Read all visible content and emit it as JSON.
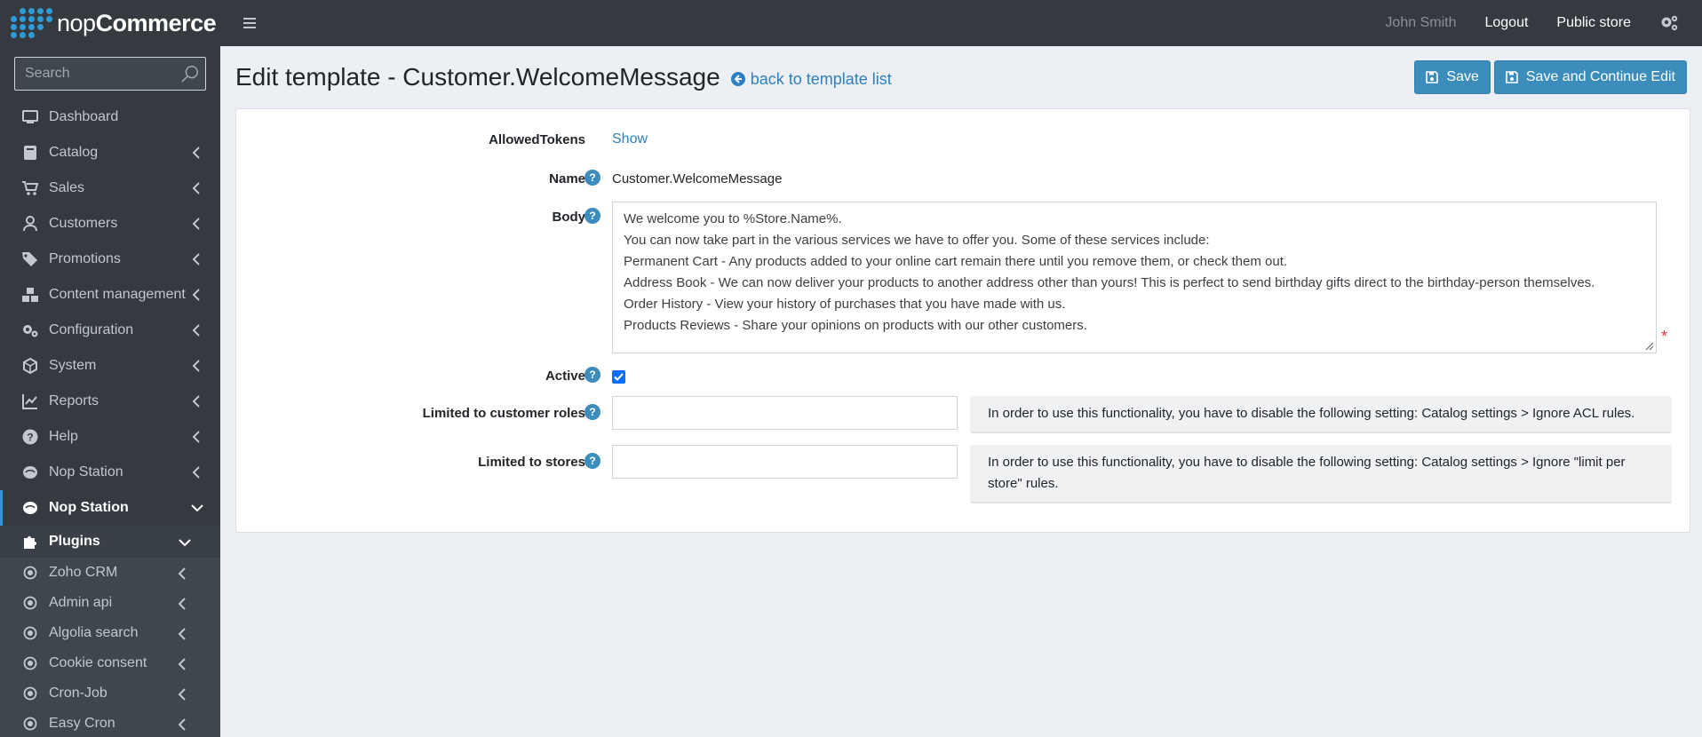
{
  "brand": {
    "name_bold": "nop",
    "name_rest": "Commerce"
  },
  "search": {
    "placeholder": "Search"
  },
  "sidebar": {
    "items": [
      {
        "label": "Dashboard",
        "icon": "monitor-icon"
      },
      {
        "label": "Catalog",
        "icon": "book-icon"
      },
      {
        "label": "Sales",
        "icon": "cart-icon"
      },
      {
        "label": "Customers",
        "icon": "user-icon"
      },
      {
        "label": "Promotions",
        "icon": "tags-icon"
      },
      {
        "label": "Content management",
        "icon": "cubes-icon"
      },
      {
        "label": "Configuration",
        "icon": "cogs-icon"
      },
      {
        "label": "System",
        "icon": "cube-icon"
      },
      {
        "label": "Reports",
        "icon": "chart-icon"
      },
      {
        "label": "Help",
        "icon": "question-icon"
      },
      {
        "label": "Nop Station",
        "icon": "nopstation-icon"
      },
      {
        "label": "Nop Station",
        "icon": "nopstation-icon"
      }
    ],
    "plugins_label": "Plugins",
    "plugin_items": [
      {
        "label": "Zoho CRM"
      },
      {
        "label": "Admin api"
      },
      {
        "label": "Algolia search"
      },
      {
        "label": "Cookie consent"
      },
      {
        "label": "Cron-Job"
      },
      {
        "label": "Easy Cron"
      }
    ]
  },
  "topbar": {
    "user": "John Smith",
    "logout": "Logout",
    "public_store": "Public store"
  },
  "page": {
    "title": "Edit template - Customer.WelcomeMessage",
    "back_link": "back to template list",
    "save": "Save",
    "save_continue": "Save and Continue Edit"
  },
  "form": {
    "allowed_tokens_label": "AllowedTokens",
    "allowed_tokens_link": "Show",
    "name_label": "Name",
    "name_value": "Customer.WelcomeMessage",
    "body_label": "Body",
    "body_lines": [
      "We welcome you to %Store.Name%.",
      "You can now take part in the various services we have to offer you. Some of these services include:",
      "Permanent Cart - Any products added to your online cart remain there until you remove them, or check them out.",
      "Address Book - We can now deliver your products to another address other than yours! This is perfect to send birthday gifts direct to the birthday-person themselves.",
      "Order History - View your history of purchases that you have made with us.",
      "Products Reviews - Share your opinions on products with our other customers."
    ],
    "required_mark": "*",
    "active_label": "Active",
    "active_checked": true,
    "roles_label": "Limited to customer roles",
    "roles_note": "In order to use this functionality, you have to disable the following setting: Catalog settings > Ignore ACL rules.",
    "stores_label": "Limited to stores",
    "stores_note": "In order to use this functionality, you have to disable the following setting: Catalog settings > Ignore \"limit per store\" rules.",
    "help_glyph": "?"
  }
}
